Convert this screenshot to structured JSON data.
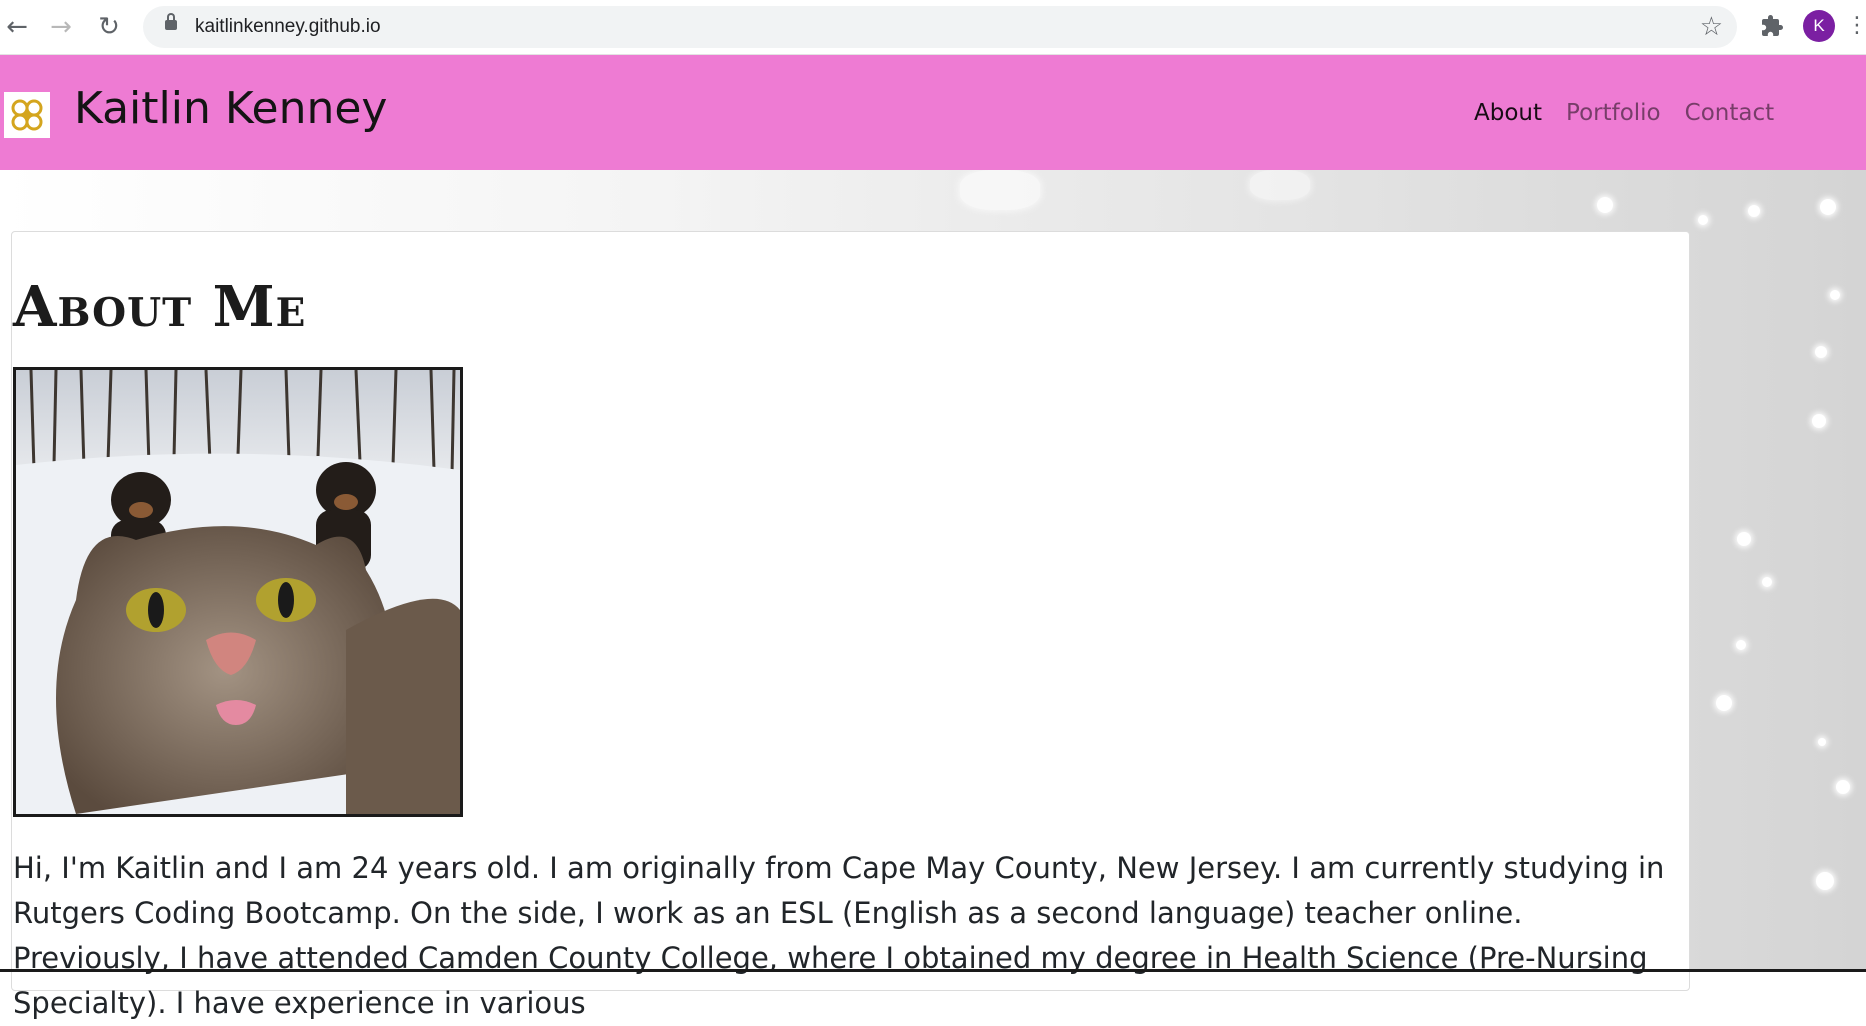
{
  "browser": {
    "url": "kaitlinkenney.github.io",
    "profile_initial": "K",
    "icons": [
      "back-arrow-icon",
      "forward-arrow-icon",
      "reload-icon",
      "lock-icon",
      "star-icon",
      "puzzle-extension-icon"
    ]
  },
  "site": {
    "brand": "Kaitlin Kenney",
    "nav": [
      {
        "label": "About",
        "active": true
      },
      {
        "label": "Portfolio",
        "active": false
      },
      {
        "label": "Contact",
        "active": false
      }
    ],
    "navbar_color": "#ee7bd3"
  },
  "about": {
    "heading": "About Me",
    "photo_alt": "cat selfie with two rottweilers in the snow",
    "bio": "Hi, I'm Kaitlin and I am 24 years old. I am originally from Cape May County, New Jersey. I am currently studying in Rutgers Coding Bootcamp. On the side, I work as an ESL (English as a second language) teacher online. Previously, I have attended Camden County College, where I obtained my degree in Health Science (Pre-Nursing Specialty). I have experience in various"
  }
}
